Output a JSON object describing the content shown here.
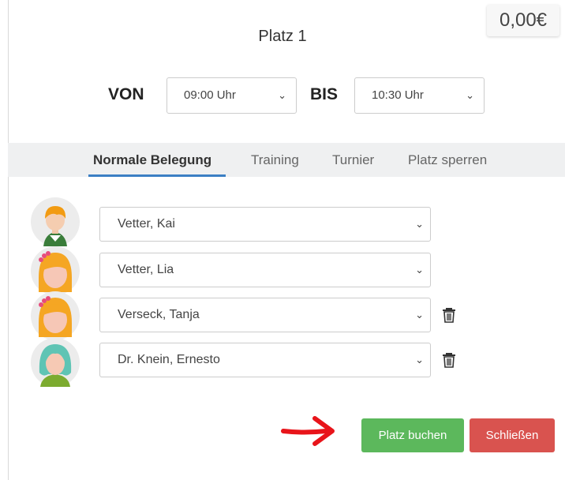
{
  "price": "0,00€",
  "title": "Platz 1",
  "time": {
    "from_label": "VON",
    "from_value": "09:00 Uhr",
    "to_label": "BIS",
    "to_value": "10:30 Uhr"
  },
  "tabs": [
    {
      "label": "Normale Belegung",
      "active": true
    },
    {
      "label": "Training",
      "active": false
    },
    {
      "label": "Turnier",
      "active": false
    },
    {
      "label": "Platz sperren",
      "active": false
    }
  ],
  "players": [
    {
      "name": "Vetter, Kai",
      "avatar": "boy-orange-hair-avatar",
      "deletable": false
    },
    {
      "name": "Vetter, Lia",
      "avatar": "girl-yellow-hair-avatar",
      "deletable": false
    },
    {
      "name": "Verseck, Tanja",
      "avatar": "girl-yellow-hair-avatar",
      "deletable": true
    },
    {
      "name": "Dr. Knein, Ernesto",
      "avatar": "teal-hair-avatar",
      "deletable": true
    }
  ],
  "buttons": {
    "book": "Platz buchen",
    "close": "Schließen"
  },
  "colors": {
    "accent_tab": "#3b7fc4",
    "book_button": "#5cb85c",
    "close_button": "#d9534f",
    "annotation_arrow": "#e8141a"
  }
}
